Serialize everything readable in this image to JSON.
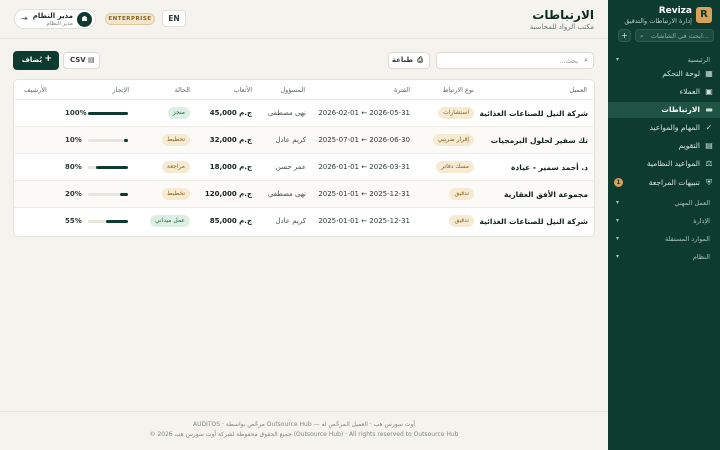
{
  "brand": {
    "logo_letter": "R",
    "name": "Reviza",
    "subtitle": "إدارة الارتباطات والتدقيق"
  },
  "sidebar": {
    "search_placeholder": "ابحث في الشاشات...",
    "add_label": "+",
    "groups": {
      "main": "الرئيسية",
      "professional": "العمل المهني",
      "admin": "الإدارة",
      "resources": "الموارد المستقلة",
      "system": "النظام"
    },
    "items": [
      {
        "label": "لوحة التحكم",
        "icon": "grid-icon",
        "glyph": "▦"
      },
      {
        "label": "العملاء",
        "icon": "clients-icon",
        "glyph": "▣"
      },
      {
        "label": "الارتباطات",
        "icon": "folder-icon",
        "glyph": "▬",
        "active": true
      },
      {
        "label": "المهام والمواعيد",
        "icon": "check-icon",
        "glyph": "✓"
      },
      {
        "label": "التقويم",
        "icon": "calendar-icon",
        "glyph": "▤"
      },
      {
        "label": "المواعيد النظامية",
        "icon": "regulatory-icon",
        "glyph": "⚖"
      },
      {
        "label": "تنبيهات المراجعة",
        "icon": "shield-icon",
        "glyph": "⛨",
        "badge": "1"
      }
    ]
  },
  "header": {
    "title": "الارتباطات",
    "subtitle": "مكتب الرواد للمحاسبة"
  },
  "user": {
    "avatar_glyph": "☗",
    "name": "مدير النظام",
    "role": "مدير النظام",
    "logout_glyph": "⇥"
  },
  "plan_badge": "ENTERPRISE",
  "lang_toggle": "EN",
  "toolbar": {
    "search_placeholder": "بحث...",
    "print_label": "طباعة",
    "csv_label": "CSV",
    "add_label": "يُضاف"
  },
  "table": {
    "headers": {
      "client": "العميل",
      "type": "نوع الارتباط",
      "period": "الفترة",
      "owner": "المسؤول",
      "fees": "الأتعاب",
      "status": "الحالة",
      "progress": "الإنجاز",
      "archive": "الأرشيف"
    },
    "rows": [
      {
        "client": "شركة النيل للصناعات الغذائية",
        "type": "استشارات",
        "period": "2026-02-01 ← 2026-05-31",
        "owner": "نهى مصطفى",
        "fees": "ج.م 45,000",
        "status": "منجز",
        "status_kind": "done",
        "progress": 100,
        "progress_label": "100%"
      },
      {
        "client": "تك سفير لحلول البرمجيات",
        "type": "إقرار ضريبي",
        "period": "2025-07-01 ← 2026-06-30",
        "owner": "كريم عادل",
        "fees": "ج.م 32,000",
        "status": "تخطيط",
        "status_kind": "plan",
        "progress": 10,
        "progress_label": "10%"
      },
      {
        "client": "د. أحمد سمير - عيادة",
        "type": "مسك دفاتر",
        "period": "2026-01-01 ← 2026-03-31",
        "owner": "عمر حسن",
        "fees": "ج.م 18,000",
        "status": "مراجعة",
        "status_kind": "rev",
        "progress": 80,
        "progress_label": "80%"
      },
      {
        "client": "مجموعة الأفق العقارية",
        "type": "تدقيق",
        "period": "2025-01-01 ← 2025-12-31",
        "owner": "نهى مصطفى",
        "fees": "ج.م 120,000",
        "status": "تخطيط",
        "status_kind": "plan",
        "progress": 20,
        "progress_label": "20%"
      },
      {
        "client": "شركة النيل للصناعات الغذائية",
        "type": "تدقيق",
        "period": "2025-01-01 ← 2025-12-31",
        "owner": "كريم عادل",
        "fees": "ج.م 85,000",
        "status": "عمل ميداني",
        "status_kind": "field",
        "progress": 55,
        "progress_label": "55%"
      }
    ]
  },
  "footer": {
    "line1": "AUDITOS · مرخّص بواسطة Outsource Hub — أوت سورس هب · العميل المرخّص له",
    "line2": "© 2026 جميع الحقوق محفوظة لشركة أوت سورس هب (Outsource Hub) · All rights reserved to Outsource Hub"
  }
}
